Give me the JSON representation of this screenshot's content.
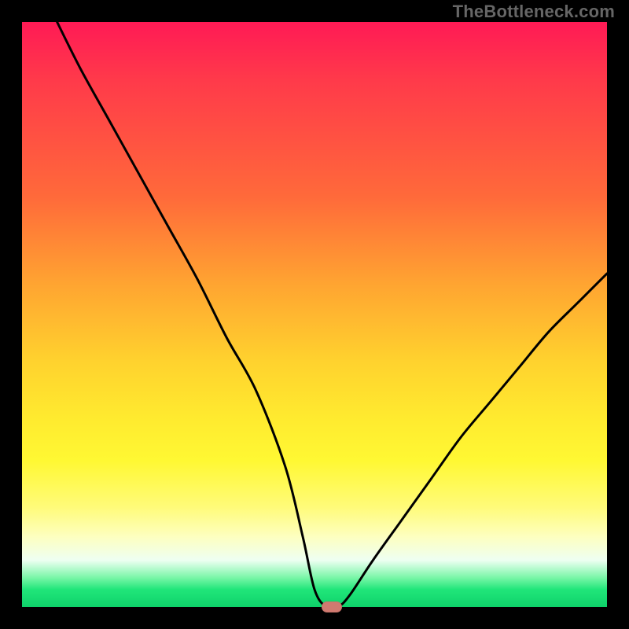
{
  "watermark": "TheBottleneck.com",
  "chart_data": {
    "type": "line",
    "title": "",
    "xlabel": "",
    "ylabel": "",
    "xlim": [
      0,
      100
    ],
    "ylim": [
      0,
      100
    ],
    "grid": false,
    "legend": false,
    "gradient_stops": [
      {
        "pos": 0,
        "color": "#ff1a55"
      },
      {
        "pos": 10,
        "color": "#ff3a4a"
      },
      {
        "pos": 30,
        "color": "#ff6a3a"
      },
      {
        "pos": 45,
        "color": "#ffa531"
      },
      {
        "pos": 58,
        "color": "#ffd22e"
      },
      {
        "pos": 68,
        "color": "#ffeb2f"
      },
      {
        "pos": 75,
        "color": "#fff833"
      },
      {
        "pos": 83,
        "color": "#fffb7a"
      },
      {
        "pos": 88,
        "color": "#fdffc0"
      },
      {
        "pos": 92,
        "color": "#eefff2"
      },
      {
        "pos": 95,
        "color": "#79f6a7"
      },
      {
        "pos": 97,
        "color": "#21e67a"
      },
      {
        "pos": 100,
        "color": "#0ed26a"
      }
    ],
    "series": [
      {
        "name": "bottleneck-curve",
        "x": [
          6,
          10,
          15,
          20,
          25,
          30,
          35,
          40,
          45,
          48,
          50,
          52,
          54,
          56,
          60,
          65,
          70,
          75,
          80,
          85,
          90,
          95,
          100
        ],
        "y": [
          100,
          92,
          83,
          74,
          65,
          56,
          46,
          37,
          24,
          12,
          3,
          0,
          0,
          2,
          8,
          15,
          22,
          29,
          35,
          41,
          47,
          52,
          57
        ]
      }
    ],
    "marker": {
      "x": 53,
      "y": 0,
      "color": "#d17a70"
    }
  }
}
